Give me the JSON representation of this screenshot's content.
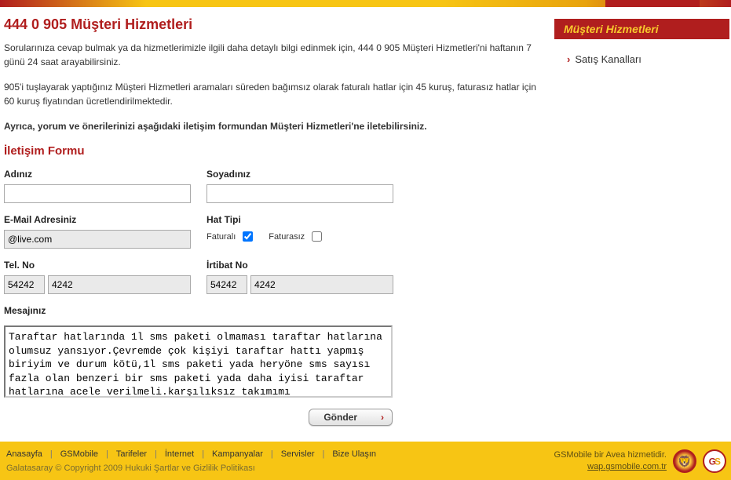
{
  "page": {
    "title": "444 0 905 Müşteri Hizmetleri",
    "p1": "Sorularınıza cevap bulmak ya da hizmetlerimizle ilgili daha detaylı bilgi edinmek için, 444 0 905 Müşteri Hizmetleri'ni haftanın 7 günü 24 saat arayabilirsiniz.",
    "p2": "905'i tuşlayarak yaptığınız Müşteri Hizmetleri aramaları süreden bağımsız olarak faturalı hatlar için 45 kuruş, faturasız hatlar için 60 kuruş fiyatından ücretlendirilmektedir.",
    "p3": "Ayrıca, yorum ve önerilerinizi aşağıdaki iletişim formundan Müşteri Hizmetleri'ne iletebilirsiniz.",
    "form_title": "İletişim Formu"
  },
  "form": {
    "name_label": "Adınız",
    "name_value": "",
    "surname_label": "Soyadınız",
    "surname_value": "",
    "email_label": "E-Mail Adresiniz",
    "email_value": "@live.com",
    "hat_label": "Hat Tipi",
    "hat_opt1": "Faturalı",
    "hat_opt2": "Faturasız",
    "tel_label": "Tel. No",
    "tel_prefix": "54242",
    "tel_number": "4242",
    "irtibat_label": "İrtibat No",
    "irtibat_prefix": "54242",
    "irtibat_number": "4242",
    "message_label": "Mesajınız",
    "message_value": "Taraftar hatlarında 1l sms paketi olmaması taraftar hatlarına olumsuz yansıyor.Çevremde çok kişiyi taraftar hattı yapmış biriyim ve durum kötü,1l sms paketi yada heryöne sms sayısı fazla olan benzeri bir sms paketi yada daha iyisi taraftar hatlarına acele verilmeli.karşılıksız takımımı destekleyeceğim diye hareket eden abone",
    "submit_label": "Gönder"
  },
  "sidebar": {
    "title": "Müşteri Hizmetleri",
    "link1": "Satış Kanalları"
  },
  "footer": {
    "links": [
      "Anasayfa",
      "GSMobile",
      "Tarifeler",
      "İnternet",
      "Kampanyalar",
      "Servisler",
      "Bize Ulaşın"
    ],
    "copyright_prefix": "Galatasaray © Copyright 2009 ",
    "legal": "Hukuki Şartlar ve Gizlilik Politikası",
    "avea_text": "GSMobile bir Avea hizmetidir.",
    "wap": "wap.gsmobile.com.tr"
  }
}
